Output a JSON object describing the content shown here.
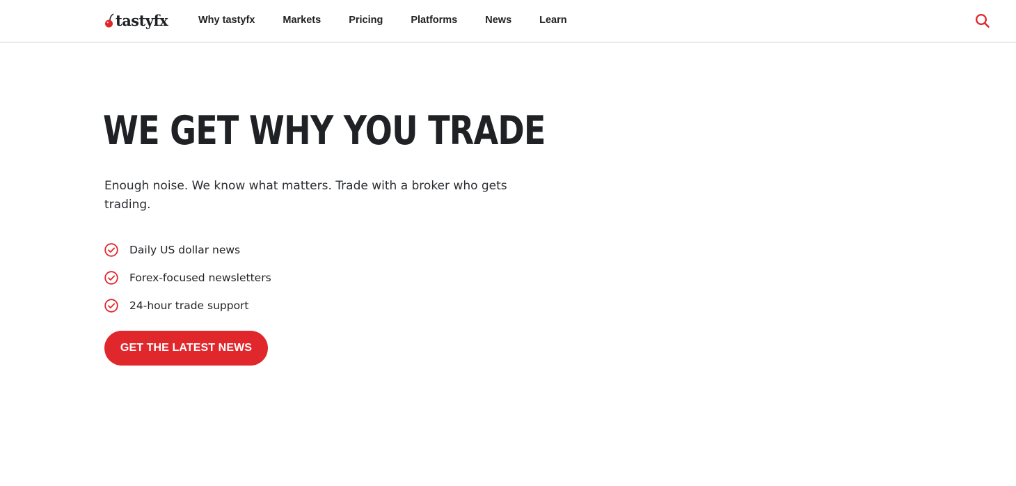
{
  "header": {
    "logo_text": "tastyfx",
    "nav": [
      {
        "label": "Why tastyfx"
      },
      {
        "label": "Markets"
      },
      {
        "label": "Pricing"
      },
      {
        "label": "Platforms"
      },
      {
        "label": "News"
      },
      {
        "label": "Learn"
      }
    ],
    "search_icon": "search-icon"
  },
  "hero": {
    "title": "WE GET WHY YOU TRADE",
    "subtitle": "Enough noise. We know what matters. Trade with a broker who gets trading.",
    "features": [
      {
        "label": "Daily US dollar news",
        "icon": "check-circle-icon"
      },
      {
        "label": "Forex-focused newsletters",
        "icon": "check-circle-icon"
      },
      {
        "label": "24-hour trade support",
        "icon": "check-circle-icon"
      }
    ],
    "cta_label": "GET THE LATEST NEWS"
  },
  "colors": {
    "brand_red": "#e0272b",
    "text_dark": "#1f2125"
  }
}
